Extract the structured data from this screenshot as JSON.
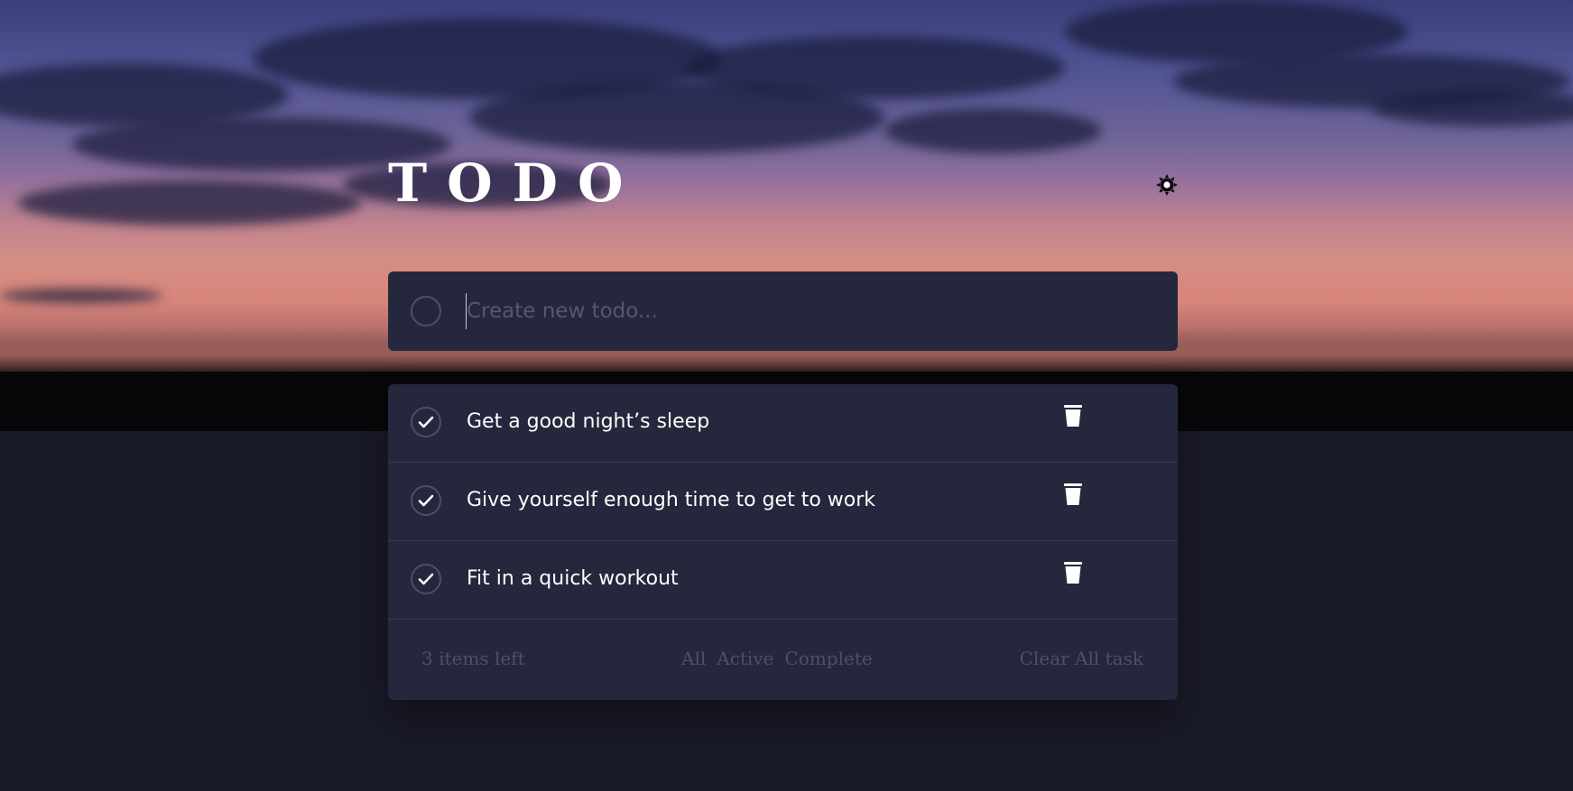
{
  "app": {
    "title": "TODO"
  },
  "theme_toggle": {
    "icon": "sun-icon"
  },
  "new_todo": {
    "placeholder": "Create new todo...",
    "value": ""
  },
  "todos": [
    {
      "text": "Get a good night’s sleep",
      "completed": true
    },
    {
      "text": "Give yourself enough time to get to work",
      "completed": true
    },
    {
      "text": "Fit in a quick workout",
      "completed": true
    }
  ],
  "footer": {
    "items_left": "3 items left",
    "filters": [
      "All",
      "Active",
      "Complete"
    ],
    "clear_label": "Clear All task"
  },
  "colors": {
    "card_bg": "#25273c",
    "page_bg": "#191a27",
    "muted_text": "#4d5067",
    "divider": "#393a4c"
  }
}
